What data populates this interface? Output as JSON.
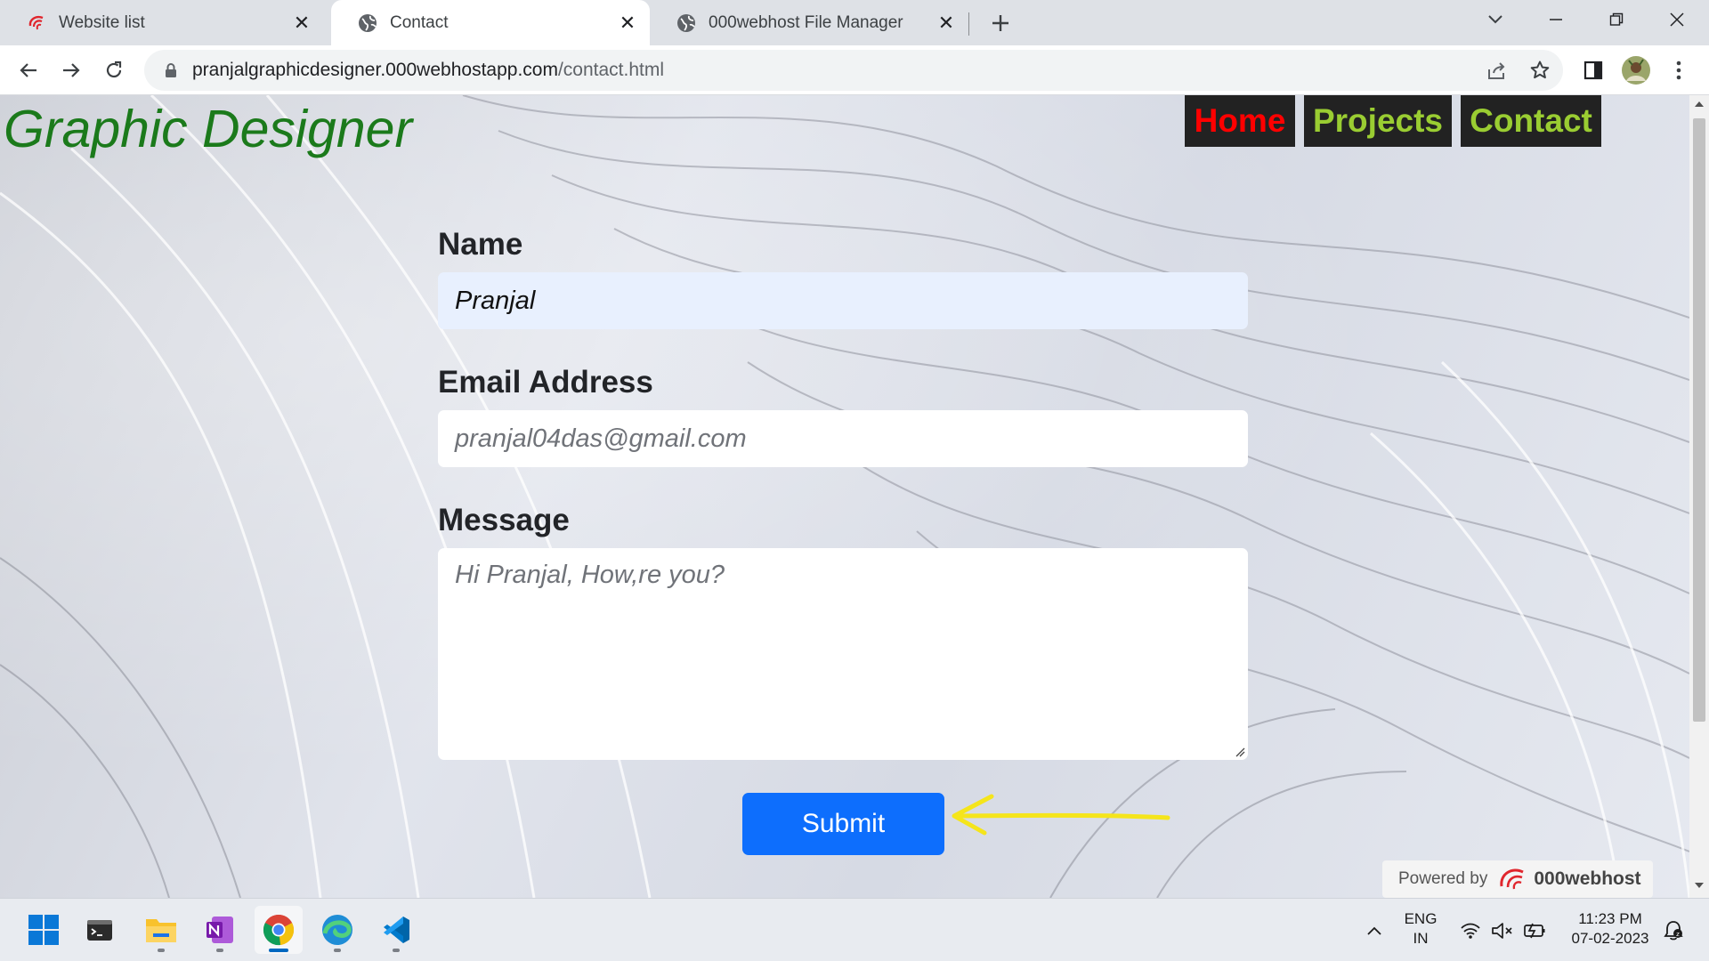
{
  "browser": {
    "tabs": [
      {
        "title": "Website list",
        "icon": "000webhost-logo-icon",
        "active": false
      },
      {
        "title": "Contact",
        "icon": "globe-icon",
        "active": true
      },
      {
        "title": "000webhost File Manager",
        "icon": "globe-icon",
        "active": false
      }
    ],
    "url_host": "pranjalgraphicdesigner.000webhostapp.com",
    "url_path": "/contact.html"
  },
  "site": {
    "title": "Graphic Designer",
    "nav": [
      {
        "label": "Home",
        "color": "#ff0000"
      },
      {
        "label": "Projects",
        "color": "#9acd32"
      },
      {
        "label": "Contact",
        "color": "#9acd32"
      }
    ]
  },
  "form": {
    "name_label": "Name",
    "name_value": "Pranjal",
    "email_label": "Email Address",
    "email_placeholder": "pranjal04das@gmail.com",
    "message_label": "Message",
    "message_placeholder": "Hi Pranjal, How,re you?",
    "submit_label": "Submit"
  },
  "footer_badge": {
    "prefix": "Powered by",
    "brand": "000webhost"
  },
  "taskbar": {
    "apps": [
      "windows-start-icon",
      "terminal-icon",
      "file-explorer-icon",
      "onenote-icon",
      "chrome-icon",
      "edge-icon",
      "vscode-icon"
    ],
    "language_line1": "ENG",
    "language_line2": "IN",
    "time": "11:23 PM",
    "date": "07-02-2023"
  },
  "colors": {
    "site_title": "#1b7a1b",
    "submit": "#0d6efd",
    "annotation_arrow": "#f5e51b"
  }
}
